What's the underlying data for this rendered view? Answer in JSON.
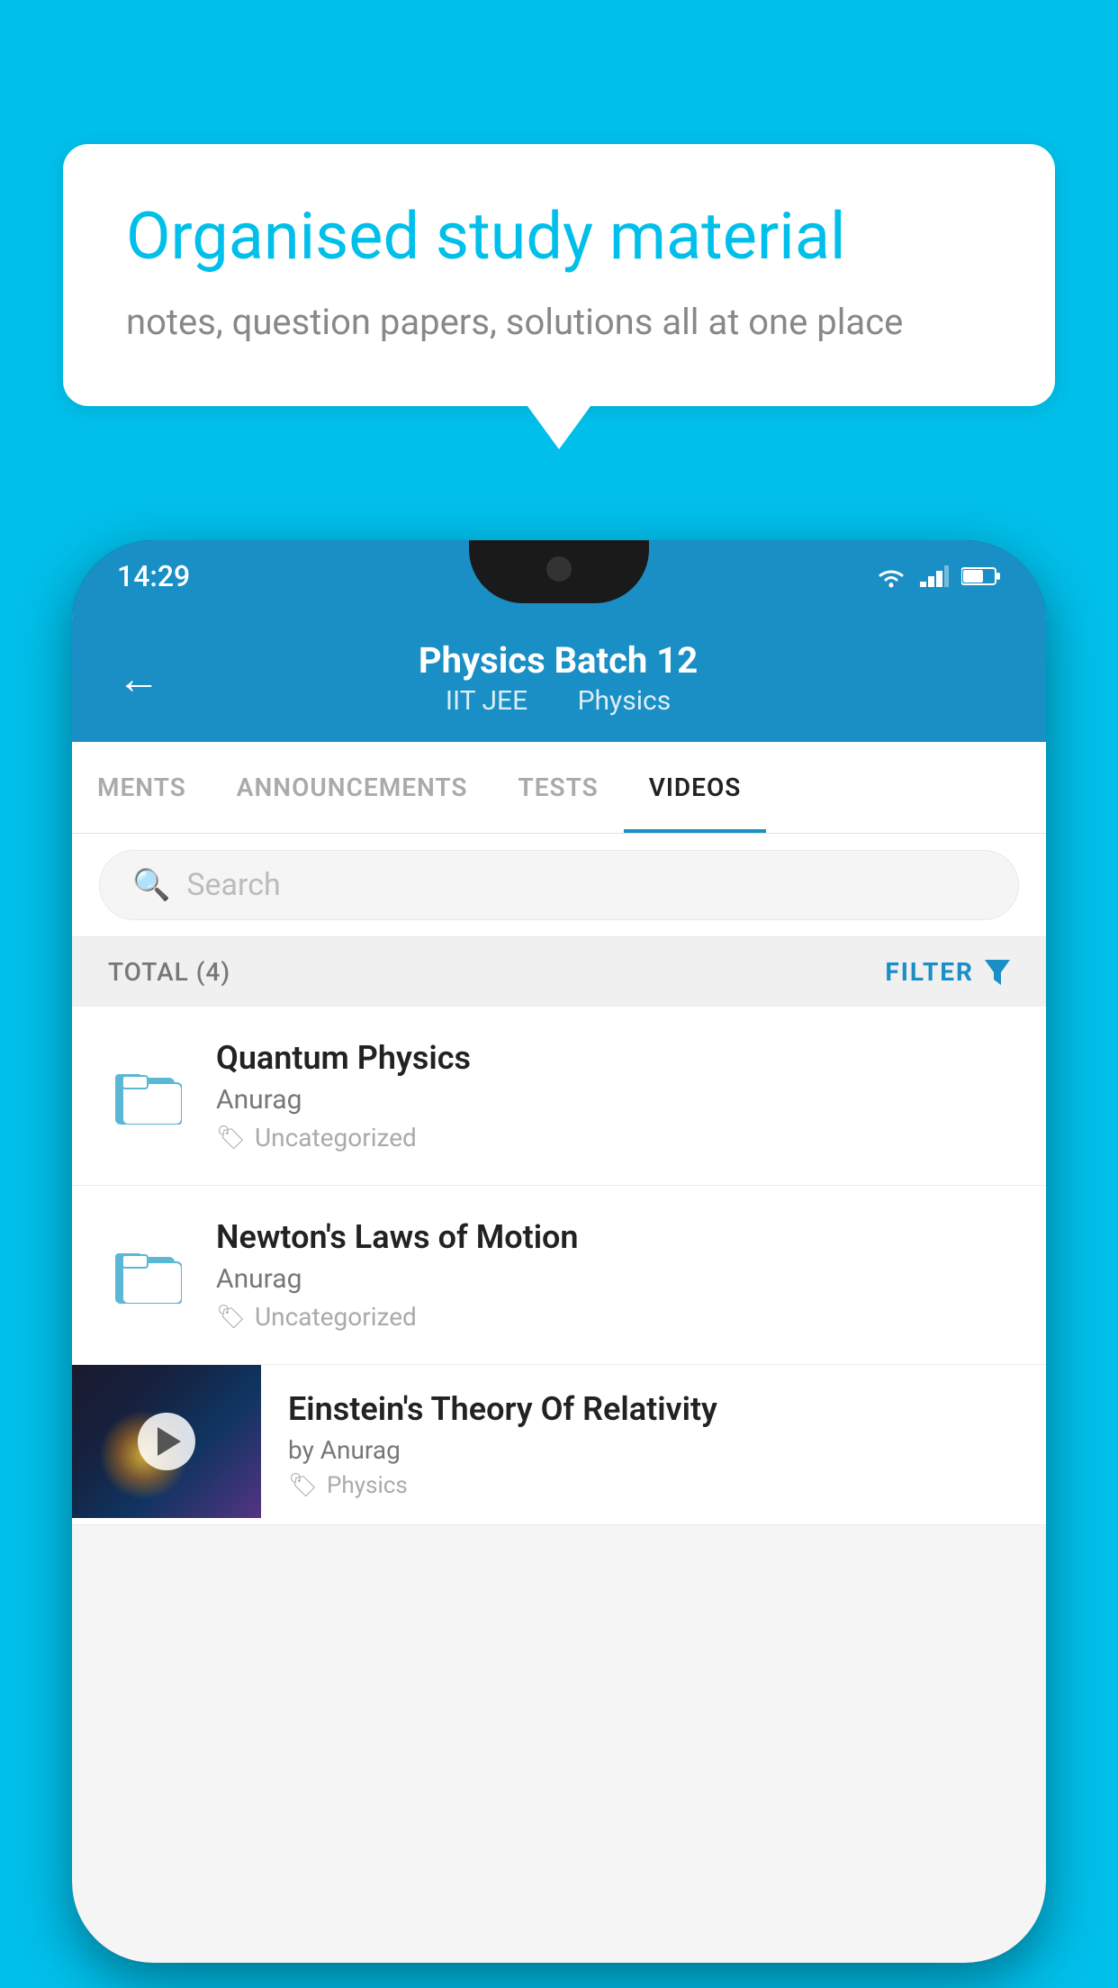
{
  "background_color": "#00BFEA",
  "speech_bubble": {
    "title": "Organised study material",
    "subtitle": "notes, question papers, solutions all at one place"
  },
  "phone": {
    "status_bar": {
      "time": "14:29",
      "wifi": "wifi",
      "signal": "signal",
      "battery": "battery"
    },
    "header": {
      "title": "Physics Batch 12",
      "subtitle_part1": "IIT JEE",
      "subtitle_part2": "Physics",
      "back_label": "back"
    },
    "tabs": [
      {
        "label": "MENTS",
        "active": false
      },
      {
        "label": "ANNOUNCEMENTS",
        "active": false
      },
      {
        "label": "TESTS",
        "active": false
      },
      {
        "label": "VIDEOS",
        "active": true
      }
    ],
    "search": {
      "placeholder": "Search"
    },
    "filter_bar": {
      "total_label": "TOTAL (4)",
      "filter_label": "FILTER"
    },
    "list_items": [
      {
        "title": "Quantum Physics",
        "author": "Anurag",
        "tag": "Uncategorized",
        "type": "folder"
      },
      {
        "title": "Newton's Laws of Motion",
        "author": "Anurag",
        "tag": "Uncategorized",
        "type": "folder"
      },
      {
        "title": "Einstein's Theory Of Relativity",
        "author": "by Anurag",
        "tag": "Physics",
        "type": "video"
      }
    ]
  }
}
